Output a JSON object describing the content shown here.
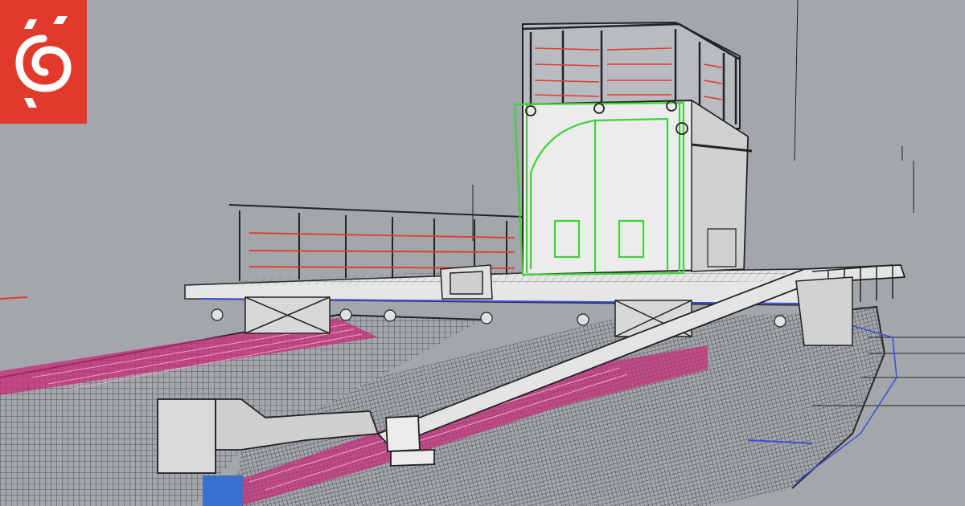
{
  "scene": {
    "subject": "boat-cad-model",
    "colors": {
      "viewport_bg": "#a3a6ab",
      "wireframe": "#2b2b2b",
      "rail_red": "#e23a2a",
      "cabin_green": "#3fd23a",
      "hull_magenta": "#c8287a",
      "section_blue": "#3a4fd8",
      "logo_red": "#e23a2a"
    }
  },
  "logo": {
    "icon": "spiral-e-logo-icon"
  }
}
